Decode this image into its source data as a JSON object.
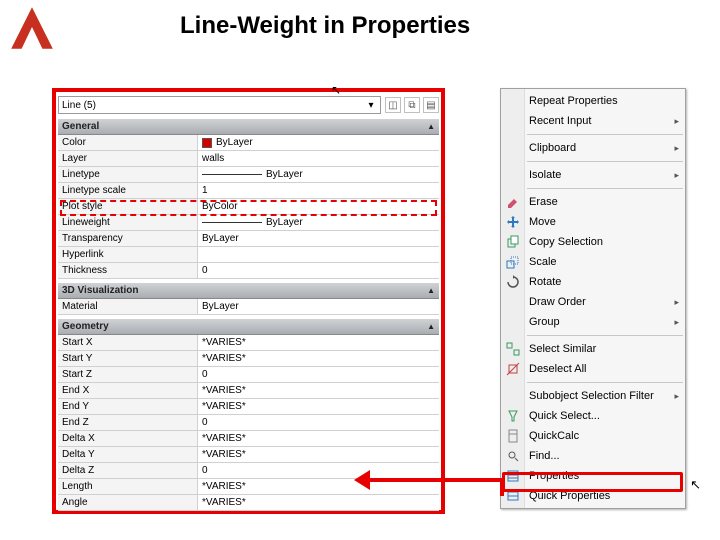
{
  "title": "Line-Weight in Properties",
  "selector": {
    "text": "Line (5)"
  },
  "icons": {
    "a": "◫",
    "b": "⧉",
    "c": "▤"
  },
  "groups": [
    {
      "name": "General",
      "rows": [
        {
          "label": "Color",
          "value": "ByLayer",
          "swatch": true
        },
        {
          "label": "Layer",
          "value": "walls"
        },
        {
          "label": "Linetype",
          "value": "ByLayer",
          "ltline": true
        },
        {
          "label": "Linetype scale",
          "value": "1"
        },
        {
          "label": "Plot style",
          "value": "ByColor"
        },
        {
          "label": "Lineweight",
          "value": "ByLayer",
          "lwline": true
        },
        {
          "label": "Transparency",
          "value": "ByLayer"
        },
        {
          "label": "Hyperlink",
          "value": ""
        },
        {
          "label": "Thickness",
          "value": "0"
        }
      ]
    },
    {
      "name": "3D Visualization",
      "rows": [
        {
          "label": "Material",
          "value": "ByLayer"
        }
      ]
    },
    {
      "name": "Geometry",
      "rows": [
        {
          "label": "Start X",
          "value": "*VARIES*"
        },
        {
          "label": "Start Y",
          "value": "*VARIES*"
        },
        {
          "label": "Start Z",
          "value": "0"
        },
        {
          "label": "End X",
          "value": "*VARIES*"
        },
        {
          "label": "End Y",
          "value": "*VARIES*"
        },
        {
          "label": "End Z",
          "value": "0"
        },
        {
          "label": "Delta X",
          "value": "*VARIES*"
        },
        {
          "label": "Delta Y",
          "value": "*VARIES*"
        },
        {
          "label": "Delta Z",
          "value": "0"
        },
        {
          "label": "Length",
          "value": "*VARIES*"
        },
        {
          "label": "Angle",
          "value": "*VARIES*"
        }
      ]
    }
  ],
  "ctx": [
    {
      "t": "Repeat Properties"
    },
    {
      "t": "Recent Input",
      "sub": true
    },
    {
      "sep": true
    },
    {
      "t": "Clipboard",
      "sub": true
    },
    {
      "sep": true
    },
    {
      "t": "Isolate",
      "sub": true
    },
    {
      "sep": true
    },
    {
      "t": "Erase",
      "icon": "erase",
      "c": "#d05070"
    },
    {
      "t": "Move",
      "icon": "move",
      "c": "#3078c0"
    },
    {
      "t": "Copy Selection",
      "icon": "copy",
      "c": "#3a9a60"
    },
    {
      "t": "Scale",
      "icon": "scale",
      "c": "#3078c0"
    },
    {
      "t": "Rotate",
      "icon": "rotate",
      "c": "#555"
    },
    {
      "t": "Draw Order",
      "sub": true
    },
    {
      "t": "Group",
      "sub": true
    },
    {
      "sep": true
    },
    {
      "t": "Select Similar",
      "icon": "selsim",
      "c": "#3a9a60"
    },
    {
      "t": "Deselect All",
      "icon": "desel",
      "c": "#c04040"
    },
    {
      "sep": true
    },
    {
      "t": "Subobject Selection Filter",
      "sub": true
    },
    {
      "t": "Quick Select...",
      "icon": "qsel",
      "c": "#3a9a60"
    },
    {
      "t": "QuickCalc",
      "icon": "calc",
      "c": "#888"
    },
    {
      "t": "Find...",
      "icon": "find",
      "c": "#555"
    },
    {
      "t": "Properties",
      "icon": "prop",
      "c": "#3078c0"
    },
    {
      "t": "Quick Properties",
      "icon": "qprop",
      "c": "#3078c0"
    }
  ]
}
